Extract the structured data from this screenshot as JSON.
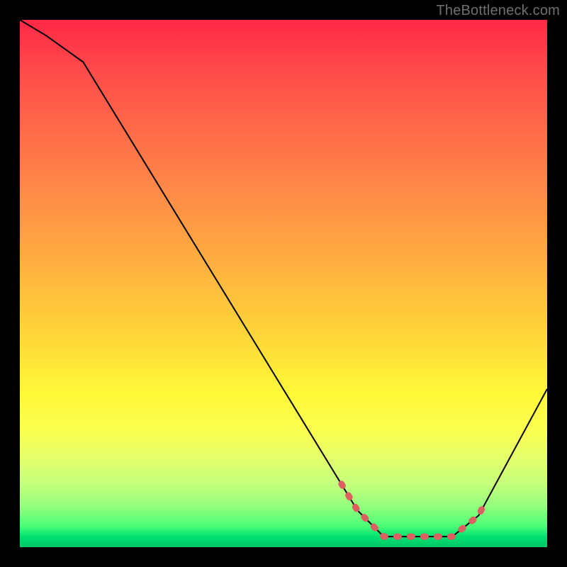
{
  "watermark_text": "TheBottleneck.com",
  "chart_data": {
    "type": "line",
    "title": "",
    "xlabel": "",
    "ylabel": "",
    "xlim": [
      0,
      100
    ],
    "ylim": [
      0,
      100
    ],
    "series": [
      {
        "name": "bottleneck-curve",
        "x": [
          0,
          5,
          12,
          64,
          69,
          82,
          87,
          100
        ],
        "values": [
          100,
          97,
          92,
          7,
          2,
          2,
          6,
          30
        ]
      }
    ],
    "annotations": [
      {
        "name": "optimal-range-marker",
        "style": "dashed",
        "color": "#dd5f62",
        "x": [
          61,
          64,
          69,
          82,
          87,
          88
        ],
        "values": [
          12,
          7,
          2,
          2,
          6,
          8
        ]
      }
    ],
    "gradient_stops": [
      {
        "pos": 0,
        "color": "#ff2846"
      },
      {
        "pos": 10,
        "color": "#ff4c4a"
      },
      {
        "pos": 22,
        "color": "#ff6d49"
      },
      {
        "pos": 34,
        "color": "#ff8e47"
      },
      {
        "pos": 46,
        "color": "#ffae40"
      },
      {
        "pos": 56,
        "color": "#ffcb3a"
      },
      {
        "pos": 64,
        "color": "#ffe338"
      },
      {
        "pos": 71,
        "color": "#fff939"
      },
      {
        "pos": 78,
        "color": "#fbff50"
      },
      {
        "pos": 83,
        "color": "#e5ff6b"
      },
      {
        "pos": 88,
        "color": "#c6ff7c"
      },
      {
        "pos": 92,
        "color": "#97ff7e"
      },
      {
        "pos": 96,
        "color": "#4bff78"
      },
      {
        "pos": 98,
        "color": "#00e06f"
      },
      {
        "pos": 100,
        "color": "#00c868"
      }
    ]
  }
}
